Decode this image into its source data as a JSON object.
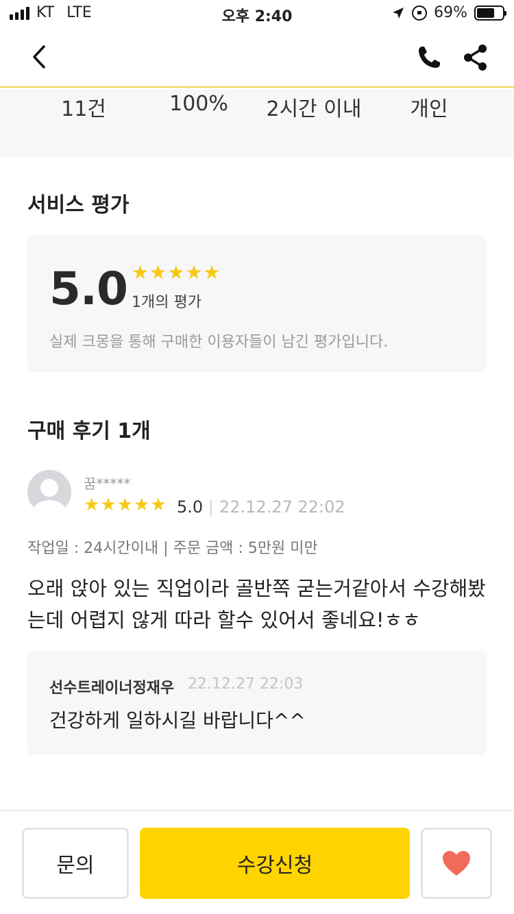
{
  "status_bar": {
    "carrier": "KT",
    "network": "LTE",
    "time": "오후 2:40",
    "battery_percent": "69%",
    "battery_level": 0.69
  },
  "nav": {
    "back_icon": "chevron-left-icon",
    "call_icon": "phone-icon",
    "share_icon": "share-icon"
  },
  "stats": [
    "11건",
    "100%",
    "2시간 이내",
    "개인"
  ],
  "rating_section": {
    "title": "서비스 평가",
    "score": "5.0",
    "stars": 5,
    "count_label": "1개의 평가",
    "note": "실제 크몽을 통해 구매한 이용자들이 남긴 평가입니다."
  },
  "reviews_section": {
    "title": "구매 후기 1개",
    "review": {
      "name": "꿈*****",
      "stars": 5,
      "score": "5.0",
      "separator": "|",
      "date": "22.12.27 22:02",
      "meta": "작업일 : 24시간이내 | 주문 금액 : 5만원 미만",
      "body_line1": "오래 앉아 있는 직업이라 골반쪽 굳는거같아서 수강해봤",
      "body_line2": "는데 어렵지 않게 따라 할수 있어서 좋네요!ㅎㅎ",
      "reply": {
        "name": "선수트레이너정재우",
        "date": "22.12.27 22:03",
        "text": "건강하게 일하시길 바랍니다^^"
      }
    }
  },
  "bottom_bar": {
    "inquiry_label": "문의",
    "apply_label": "수강신청",
    "favorite_icon": "heart-icon"
  },
  "colors": {
    "accent": "#ffd400",
    "star": "#f6c915",
    "heart": "#f06b5a",
    "panel": "#f6f7f9"
  }
}
